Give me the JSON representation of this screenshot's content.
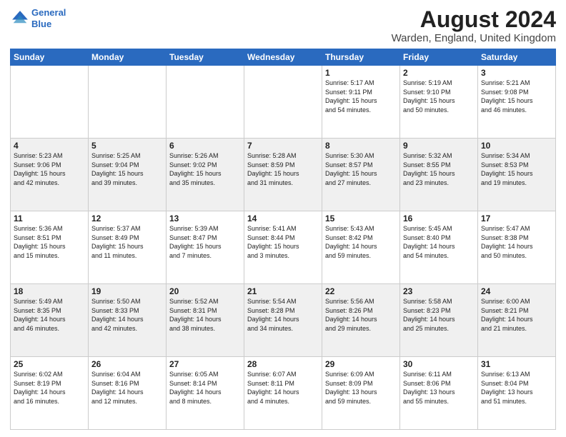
{
  "header": {
    "logo_line1": "General",
    "logo_line2": "Blue",
    "title": "August 2024",
    "subtitle": "Warden, England, United Kingdom"
  },
  "weekdays": [
    "Sunday",
    "Monday",
    "Tuesday",
    "Wednesday",
    "Thursday",
    "Friday",
    "Saturday"
  ],
  "rows": [
    [
      {
        "day": "",
        "info": ""
      },
      {
        "day": "",
        "info": ""
      },
      {
        "day": "",
        "info": ""
      },
      {
        "day": "",
        "info": ""
      },
      {
        "day": "1",
        "info": "Sunrise: 5:17 AM\nSunset: 9:11 PM\nDaylight: 15 hours\nand 54 minutes."
      },
      {
        "day": "2",
        "info": "Sunrise: 5:19 AM\nSunset: 9:10 PM\nDaylight: 15 hours\nand 50 minutes."
      },
      {
        "day": "3",
        "info": "Sunrise: 5:21 AM\nSunset: 9:08 PM\nDaylight: 15 hours\nand 46 minutes."
      }
    ],
    [
      {
        "day": "4",
        "info": "Sunrise: 5:23 AM\nSunset: 9:06 PM\nDaylight: 15 hours\nand 42 minutes."
      },
      {
        "day": "5",
        "info": "Sunrise: 5:25 AM\nSunset: 9:04 PM\nDaylight: 15 hours\nand 39 minutes."
      },
      {
        "day": "6",
        "info": "Sunrise: 5:26 AM\nSunset: 9:02 PM\nDaylight: 15 hours\nand 35 minutes."
      },
      {
        "day": "7",
        "info": "Sunrise: 5:28 AM\nSunset: 8:59 PM\nDaylight: 15 hours\nand 31 minutes."
      },
      {
        "day": "8",
        "info": "Sunrise: 5:30 AM\nSunset: 8:57 PM\nDaylight: 15 hours\nand 27 minutes."
      },
      {
        "day": "9",
        "info": "Sunrise: 5:32 AM\nSunset: 8:55 PM\nDaylight: 15 hours\nand 23 minutes."
      },
      {
        "day": "10",
        "info": "Sunrise: 5:34 AM\nSunset: 8:53 PM\nDaylight: 15 hours\nand 19 minutes."
      }
    ],
    [
      {
        "day": "11",
        "info": "Sunrise: 5:36 AM\nSunset: 8:51 PM\nDaylight: 15 hours\nand 15 minutes."
      },
      {
        "day": "12",
        "info": "Sunrise: 5:37 AM\nSunset: 8:49 PM\nDaylight: 15 hours\nand 11 minutes."
      },
      {
        "day": "13",
        "info": "Sunrise: 5:39 AM\nSunset: 8:47 PM\nDaylight: 15 hours\nand 7 minutes."
      },
      {
        "day": "14",
        "info": "Sunrise: 5:41 AM\nSunset: 8:44 PM\nDaylight: 15 hours\nand 3 minutes."
      },
      {
        "day": "15",
        "info": "Sunrise: 5:43 AM\nSunset: 8:42 PM\nDaylight: 14 hours\nand 59 minutes."
      },
      {
        "day": "16",
        "info": "Sunrise: 5:45 AM\nSunset: 8:40 PM\nDaylight: 14 hours\nand 54 minutes."
      },
      {
        "day": "17",
        "info": "Sunrise: 5:47 AM\nSunset: 8:38 PM\nDaylight: 14 hours\nand 50 minutes."
      }
    ],
    [
      {
        "day": "18",
        "info": "Sunrise: 5:49 AM\nSunset: 8:35 PM\nDaylight: 14 hours\nand 46 minutes."
      },
      {
        "day": "19",
        "info": "Sunrise: 5:50 AM\nSunset: 8:33 PM\nDaylight: 14 hours\nand 42 minutes."
      },
      {
        "day": "20",
        "info": "Sunrise: 5:52 AM\nSunset: 8:31 PM\nDaylight: 14 hours\nand 38 minutes."
      },
      {
        "day": "21",
        "info": "Sunrise: 5:54 AM\nSunset: 8:28 PM\nDaylight: 14 hours\nand 34 minutes."
      },
      {
        "day": "22",
        "info": "Sunrise: 5:56 AM\nSunset: 8:26 PM\nDaylight: 14 hours\nand 29 minutes."
      },
      {
        "day": "23",
        "info": "Sunrise: 5:58 AM\nSunset: 8:23 PM\nDaylight: 14 hours\nand 25 minutes."
      },
      {
        "day": "24",
        "info": "Sunrise: 6:00 AM\nSunset: 8:21 PM\nDaylight: 14 hours\nand 21 minutes."
      }
    ],
    [
      {
        "day": "25",
        "info": "Sunrise: 6:02 AM\nSunset: 8:19 PM\nDaylight: 14 hours\nand 16 minutes."
      },
      {
        "day": "26",
        "info": "Sunrise: 6:04 AM\nSunset: 8:16 PM\nDaylight: 14 hours\nand 12 minutes."
      },
      {
        "day": "27",
        "info": "Sunrise: 6:05 AM\nSunset: 8:14 PM\nDaylight: 14 hours\nand 8 minutes."
      },
      {
        "day": "28",
        "info": "Sunrise: 6:07 AM\nSunset: 8:11 PM\nDaylight: 14 hours\nand 4 minutes."
      },
      {
        "day": "29",
        "info": "Sunrise: 6:09 AM\nSunset: 8:09 PM\nDaylight: 13 hours\nand 59 minutes."
      },
      {
        "day": "30",
        "info": "Sunrise: 6:11 AM\nSunset: 8:06 PM\nDaylight: 13 hours\nand 55 minutes."
      },
      {
        "day": "31",
        "info": "Sunrise: 6:13 AM\nSunset: 8:04 PM\nDaylight: 13 hours\nand 51 minutes."
      }
    ]
  ],
  "alt_rows": [
    1,
    3
  ],
  "colors": {
    "header_bg": "#2a6abf",
    "alt_row_bg": "#f0f0f0",
    "normal_row_bg": "#ffffff"
  }
}
